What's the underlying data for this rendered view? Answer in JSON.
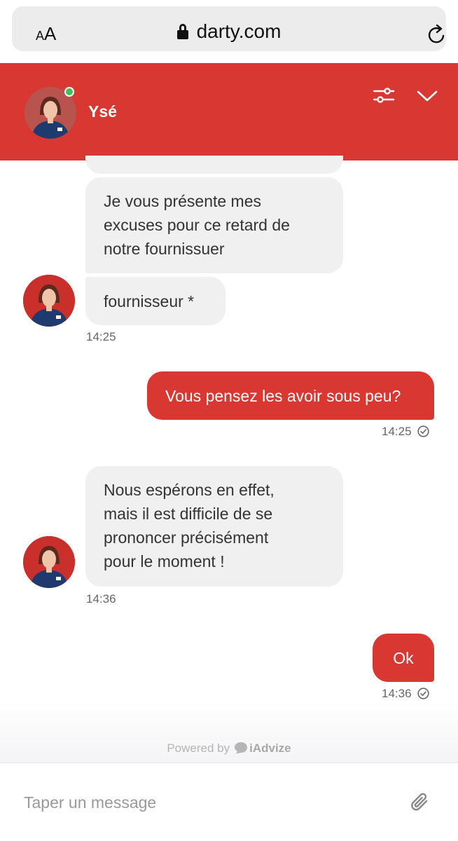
{
  "browser": {
    "text_size_small": "A",
    "text_size_large": "A",
    "domain": "darty.com"
  },
  "header": {
    "agent_name": "Ysé",
    "online": true
  },
  "messages": [
    {
      "from": "agent",
      "text_lines": [
        "Je vous présente mes",
        "excuses pour ce retard de",
        "notre fournissuer"
      ]
    },
    {
      "from": "agent",
      "text_lines": [
        "fournisseur *"
      ],
      "time": "14:25"
    },
    {
      "from": "user",
      "text_lines": [
        "Vous pensez les avoir sous peu?"
      ],
      "time": "14:25"
    },
    {
      "from": "agent",
      "text_lines": [
        "Nous espérons en effet,",
        "mais il est difficile de se",
        "prononcer précisément",
        "pour le moment !"
      ],
      "time": "14:36"
    },
    {
      "from": "user",
      "text_lines": [
        "Ok"
      ],
      "time": "14:36"
    }
  ],
  "footer": {
    "powered_by": "Powered by",
    "brand": "iAdvize",
    "input_placeholder": "Taper un message"
  },
  "colors": {
    "brand_red": "#d93732",
    "agent_bubble": "#f0f0f0",
    "online_green": "#3fbf5a"
  },
  "icons": [
    "lock-icon",
    "reload-icon",
    "settings-sliders-icon",
    "chevron-down-icon",
    "check-circle-icon",
    "paperclip-icon",
    "iadvize-logo-icon"
  ]
}
